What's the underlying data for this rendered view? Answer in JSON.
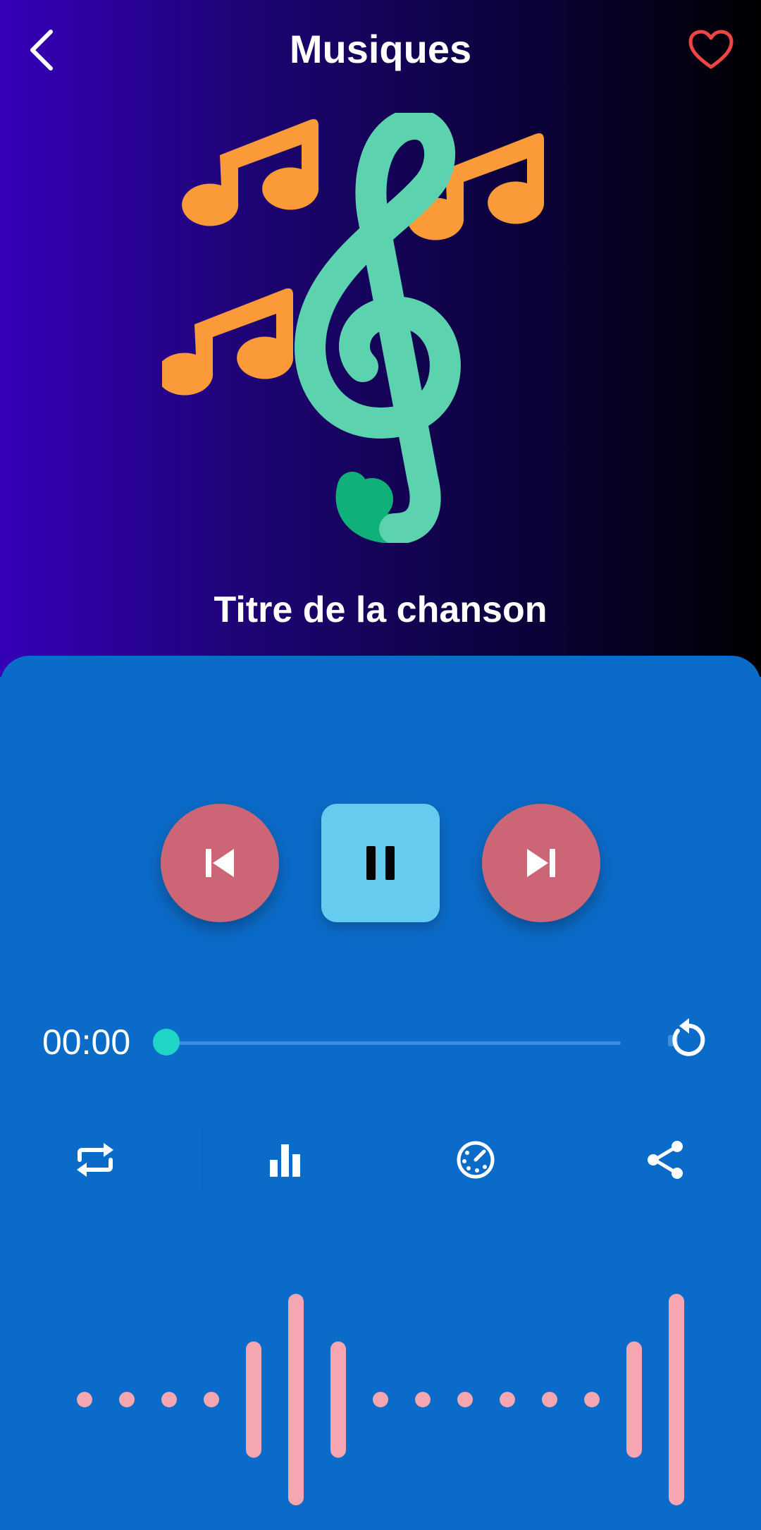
{
  "header": {
    "title": "Musiques",
    "back_icon": "chevron-left-icon",
    "favorite_icon": "heart-outline-icon",
    "favorite_color": "#ef4444"
  },
  "artwork": {
    "icon": "music-notes-treble-clef-icon",
    "clef_color": "#5cd3ae",
    "note_color": "#fb9a38"
  },
  "song": {
    "title": "Titre de la chanson"
  },
  "controls": {
    "previous_icon": "skip-previous-icon",
    "play_pause_icon": "pause-icon",
    "next_icon": "skip-next-icon",
    "round_button_color": "#cc6677",
    "play_button_color": "#66ccef"
  },
  "progress": {
    "current_time": "00:00",
    "fraction": 0.0,
    "thumb_color": "#1fd6c6",
    "replay_icon": "replay-icon"
  },
  "tools": [
    {
      "name": "repeat-button",
      "icon": "repeat-icon"
    },
    {
      "name": "equalizer-button",
      "icon": "bar-chart-icon"
    },
    {
      "name": "timer-button",
      "icon": "timer-icon"
    },
    {
      "name": "share-button",
      "icon": "share-icon"
    }
  ],
  "visualizer": {
    "color": "#f5a6b1",
    "levels": [
      0.06,
      0.06,
      0.06,
      0.06,
      0.55,
      1.0,
      0.55,
      0.06,
      0.06,
      0.06,
      0.06,
      0.06,
      0.06,
      0.55,
      1.0
    ]
  },
  "colors": {
    "panel": "#0b6bc8",
    "hero_gradient_start": "#3600b8",
    "hero_gradient_end": "#000000"
  }
}
